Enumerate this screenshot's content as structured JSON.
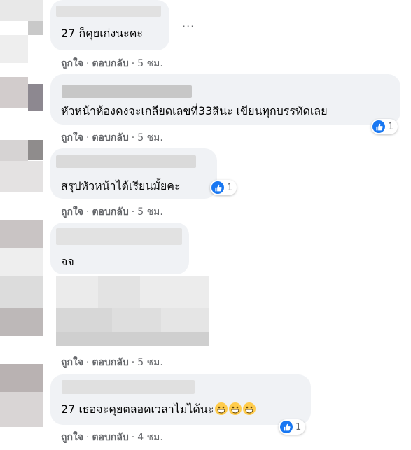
{
  "comments": [
    {
      "text": "27 ก็คุยเก่งนะคะ",
      "meta": {
        "like": "ถูกใจ",
        "reply": "ตอบกลับ",
        "time": "5 ชม."
      }
    },
    {
      "text": "หัวหน้าห้องคงจะเกลียดเลขที่33สินะ เขียนทุกบรรทัดเลย",
      "reaction_count": "1",
      "meta": {
        "like": "ถูกใจ",
        "reply": "ตอบกลับ",
        "time": "5 ชม."
      }
    },
    {
      "text": "สรุปหัวหน้าได้เรียนมั้ยคะ",
      "reaction_count": "1",
      "meta": {
        "like": "ถูกใจ",
        "reply": "ตอบกลับ",
        "time": "5 ชม."
      }
    },
    {
      "text": "จจ",
      "meta": {
        "like": "ถูกใจ",
        "reply": "ตอบกลับ",
        "time": "5 ชม."
      }
    },
    {
      "text": "27 เธอจะคุยตลอดเวลาไม่ได้นะ",
      "reaction_count": "1",
      "meta": {
        "like": "ถูกใจ",
        "reply": "ตอบกลับ",
        "time": "4 ชม."
      }
    }
  ],
  "more_options": "···",
  "colors": {
    "bubble": "#f0f2f5",
    "meta": "#65676b",
    "like_blue": "#1877f2"
  },
  "icons": {
    "reaction": "like-thumb-icon",
    "emoji": "grinning-face-icon"
  }
}
